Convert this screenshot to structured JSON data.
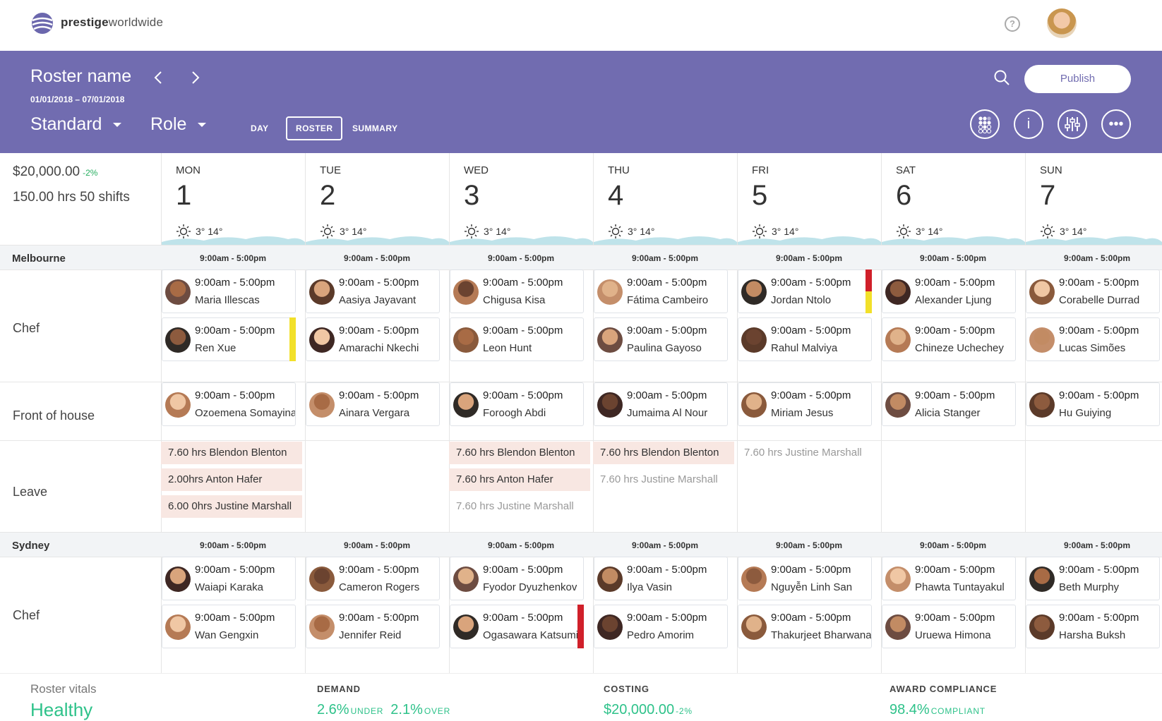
{
  "brand": {
    "bold": "prestige",
    "light": "worldwide"
  },
  "topbar": {
    "help_icon": "?"
  },
  "header": {
    "roster_name": "Roster name",
    "date_range": "01/01/2018 – 07/01/2018",
    "view_select": "Standard",
    "group_select": "Role",
    "tabs": [
      "DAY",
      "ROSTER",
      "SUMMARY"
    ],
    "active_tab": "ROSTER",
    "publish_label": "Publish",
    "info_icon": "i",
    "more_icon": "•••"
  },
  "summary": {
    "cost": "$20,000.00",
    "cost_delta": "-2%",
    "hours": "150.00 hrs 50 shifts"
  },
  "days": [
    {
      "name": "MON",
      "num": "1",
      "weather": "3° 14°"
    },
    {
      "name": "TUE",
      "num": "2",
      "weather": "3° 14°"
    },
    {
      "name": "WED",
      "num": "3",
      "weather": "3° 14°"
    },
    {
      "name": "THU",
      "num": "4",
      "weather": "3° 14°"
    },
    {
      "name": "FRI",
      "num": "5",
      "weather": "3° 14°"
    },
    {
      "name": "SAT",
      "num": "6",
      "weather": "3° 14°"
    },
    {
      "name": "SUN",
      "num": "7",
      "weather": "3° 14°"
    }
  ],
  "shift_time": "9:00am - 5:00pm",
  "locations": [
    {
      "name": "Melbourne",
      "band_time": "9:00am - 5:00pm"
    },
    {
      "name": "Sydney",
      "band_time": "9:00am - 5:00pm"
    }
  ],
  "roles": {
    "chef": "Chef",
    "foh": "Front of house",
    "leave": "Leave"
  },
  "melbourne_chef_row1": [
    "Maria Illescas",
    "Aasiya Jayavant",
    "Chigusa Kisa",
    "Fátima Cambeiro",
    "Jordan Ntolo",
    "Alexander Ljung",
    "Corabelle Durrad"
  ],
  "melbourne_chef_row2": [
    "Ren Xue",
    "Amarachi Nkechi",
    "Leon Hunt",
    "Paulina Gayoso",
    "Rahul Malviya",
    "Chineze Uchechey",
    "Lucas Simões"
  ],
  "melbourne_foh": [
    "Ozoemena Somayina",
    "Ainara Vergara",
    "Foroogh Abdi",
    "Jumaima Al Nour",
    "Miriam Jesus",
    "Alicia Stanger",
    "Hu Guiying"
  ],
  "leave": {
    "mon": [
      "7.60 hrs  Blendon Blenton",
      "2.00hrs  Anton Hafer",
      "6.00 0hrs  Justine Marshall"
    ],
    "wed": [
      "7.60 hrs  Blendon Blenton",
      "7.60 hrs  Anton Hafer",
      "7.60 hrs  Justine Marshall"
    ],
    "thu": [
      "7.60 hrs  Blendon Blenton",
      "7.60 hrs  Justine Marshall"
    ],
    "fri": [
      "7.60 hrs  Justine Marshall"
    ]
  },
  "sydney_chef_row1": [
    "Waiapi Karaka",
    "Cameron Rogers",
    "Fyodor Dyuzhenkov",
    "Ilya Vasin",
    "Nguyễn Linh San",
    "Phawta Tuntayakul",
    "Beth Murphy"
  ],
  "sydney_chef_row2": [
    "Wan Gengxin",
    "Jennifer Reid",
    "Ogasawara Katsumi",
    "Pedro Amorim",
    "Thakurjeet Bharwana",
    "Uruewa Himona",
    "Harsha Buksh"
  ],
  "flags": {
    "warning": "#f2e02a",
    "error": "#d0202a"
  },
  "footer": {
    "vitals_label": "Roster vitals",
    "vitals_status": "Healthy",
    "demand_title": "DEMAND",
    "demand_under": "2.6%",
    "demand_under_label": "UNDER",
    "demand_over": "2.1%",
    "demand_over_label": "OVER",
    "costing_title": "COSTING",
    "costing_val": "$20,000.00",
    "costing_delta": "-2%",
    "award_title": "AWARD COMPLIANCE",
    "award_val": "98.4%",
    "award_label": "COMPLIANT"
  }
}
